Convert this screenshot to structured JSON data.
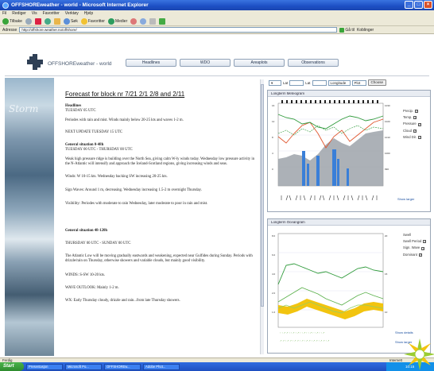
{
  "window": {
    "title": "OFFSHOREweather - world - Microsoft Internet Explorer",
    "minimize": "_",
    "maximize": "□",
    "close": "×"
  },
  "menu": [
    "Fil",
    "Rediger",
    "Vis",
    "Favoritter",
    "Verktøy",
    "Hjelp"
  ],
  "toolbar": {
    "back": "Tilbake",
    "search": "Søk",
    "favorites": "Favoritter",
    "media": "Medier"
  },
  "address": {
    "label": "Adresse",
    "url": "http://offshore.weather.no/offshore/",
    "go": "Gå til",
    "links": "Koblinger"
  },
  "site": {
    "name": "OFFSHOREweather - world",
    "nav": [
      "Headlines",
      "WDO",
      "Areaplots",
      "Observations"
    ]
  },
  "storm_label": "Storm",
  "forecast": {
    "title": "Forecast for block nr 7/21 2/1 2/8 and 2/11",
    "headlines_h": "Headlines",
    "headlines_time": "TUESDAY 05 UTC",
    "headlines_text": "Periodes with rain and mist. Winds mainly below 20-25 kts and waves 1-2 m.",
    "next_update": "NEXT UPDATE TUESDAY 15 UTC",
    "gen1_h": "General situation 0-48h",
    "gen1_time": "TUESDAY 00 UTC - THURSDAY 00 UTC",
    "gen1_text": "Weak high pressure ridge is building over the North Sea, giving calm W-ly winds today. Wednesday low pressure activity in the N-Atlantic will intensify and approach the Iceland-Scotland regions, giving increasing winds and seas.",
    "winds": "Winds: W 10-15 kts. Wednesday backing SW increasing 20-25 kts.",
    "sigwaves": "Sign Waves: Around 1 m, decreasing. Wednesday increasing 1.5-2 m overnight Thursday.",
    "visibility": "Visibility: Periodes with moderate to rain Wednesday, later moderate to poor in rain and mist.",
    "gen2_h": "General situation 48-120h",
    "gen2_time": "THURSDAY 00 UTC - SUNDAY 00 UTC",
    "gen2_text": "The Atlantic Low will be moving gradually eastwards and weakening, expected near Gulfides during Sunday. Periods with drizzle/rain on Thursday, otherwise showers and variable clouds, but mainly good visibility.",
    "winds2": "WINDS: S-SW 10-20 kts.",
    "wave_outlook": "WAVE OUTLOOK: Mainly 1-2 m.",
    "wx": "WX: Early Thursday cloudy, drizzle and rain...from late Thursday showers."
  },
  "controls": {
    "lat_label": "Lat",
    "lon_label": "Lat",
    "lon_value": "Longitude",
    "plot_value": "Plot",
    "button": "Choose"
  },
  "panel1": {
    "head": "Longterm Meteogram",
    "legend": [
      "Precip.",
      "Temp.",
      "Pressure",
      "Cloud",
      "Wind Dir."
    ],
    "note": "Show larger"
  },
  "panel2": {
    "head": "Longterm Oceangram",
    "legend": [
      "Swell",
      "Swell Period",
      "Sign. Wave",
      "Dominant"
    ],
    "note_a": "Show details",
    "note_b": "Show larger"
  },
  "status": {
    "left": "Ferdig",
    "zone": "Internett"
  },
  "taskbar": {
    "start": "Start",
    "tasks": [
      "Presentasjon",
      "Microsoft Po...",
      "OFFSHOREw...",
      "Adobe Phot..."
    ],
    "clock": "10:15"
  },
  "colors": {
    "ie_blue": "#1d4fc4",
    "temp_red": "#e0552d",
    "series_green": "#2e9a3a",
    "precip_blue": "#3a7fd8",
    "cloud_gray": "#9da3aa",
    "swell_yellow": "#f2c40f"
  }
}
